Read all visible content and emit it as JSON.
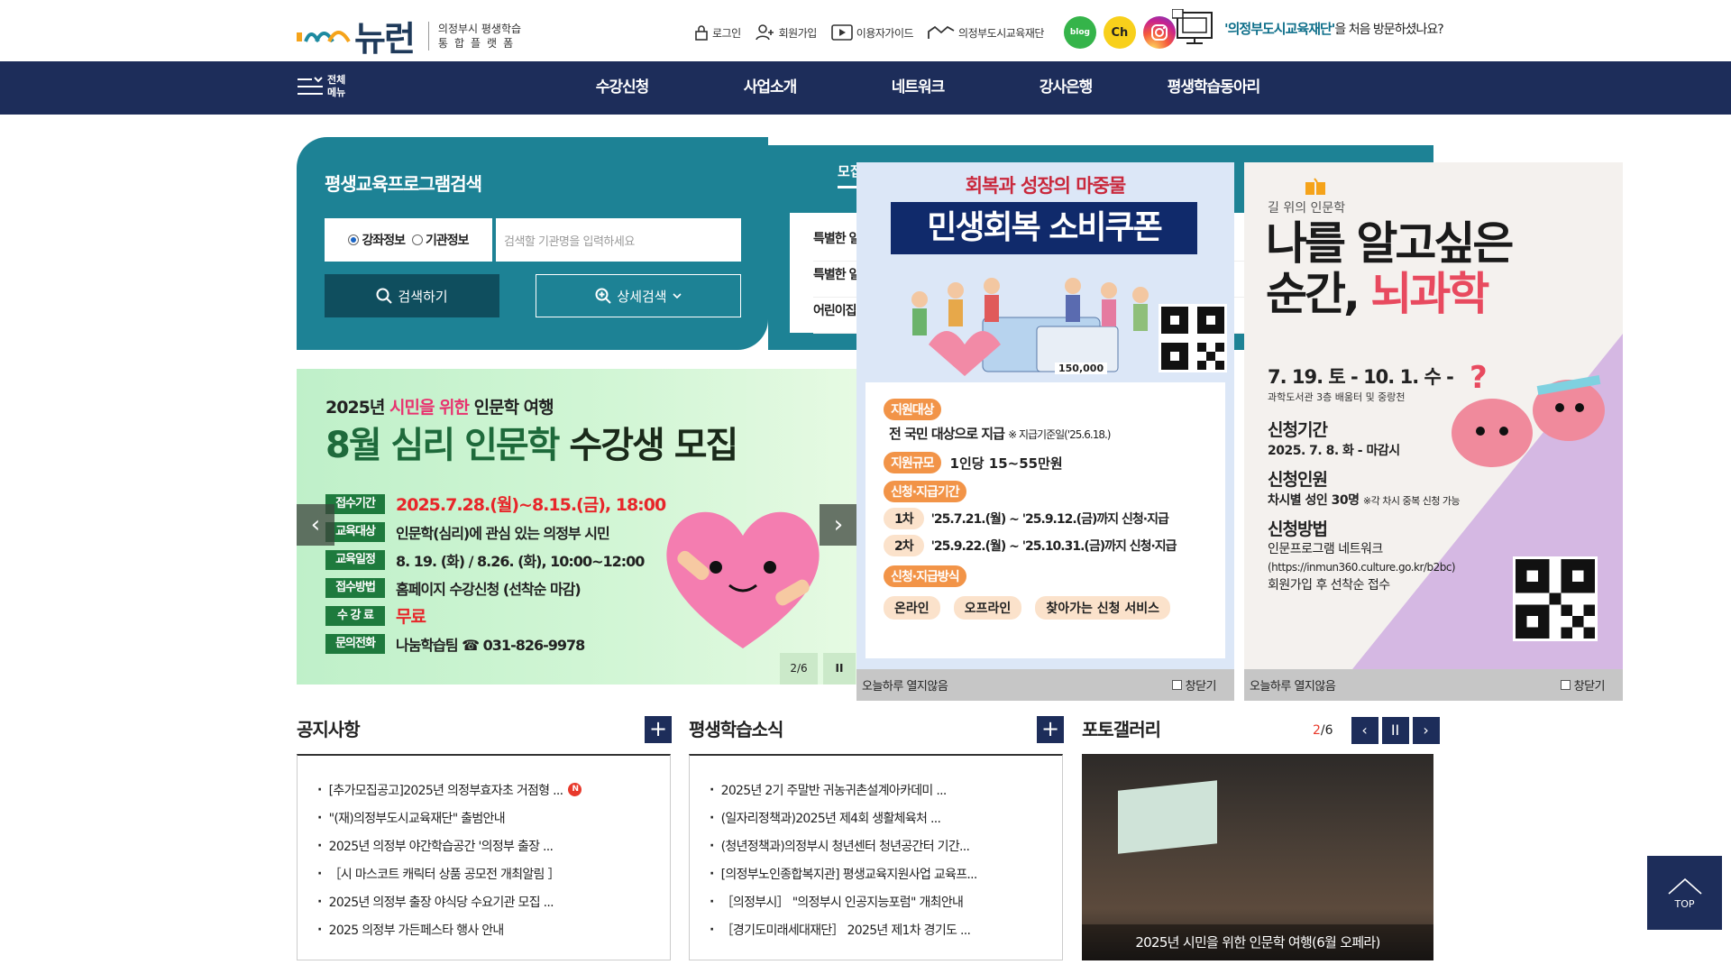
{
  "header": {
    "logo_text": "뉴런",
    "logo_sub1": "의정부시 평생학습",
    "logo_sub2": "통합플랫폼",
    "util": [
      {
        "label": "로그인",
        "icon": "lock-icon"
      },
      {
        "label": "회원가입",
        "icon": "user-plus-icon"
      },
      {
        "label": "이용자가이드",
        "icon": "play-icon"
      },
      {
        "label": "의정부도시교육재단",
        "icon": "chart-icon"
      }
    ],
    "sns": [
      "blog",
      "Ch",
      "instagram"
    ],
    "visit_title": "'의정부도시교육재단'",
    "visit_rest": "을 처음 방문하셨나요?"
  },
  "nav": {
    "allmenu_line1": "전체",
    "allmenu_line2": "메뉴",
    "items": [
      "수강신청",
      "사업소개",
      "네트워크",
      "강사은행",
      "평생학습동아리"
    ]
  },
  "search": {
    "title": "평생교육프로그램검색",
    "radio1": "강좌정보",
    "radio2": "기관정보",
    "placeholder": "검색할 기관명을 입력하세요",
    "btn_search": "검색하기",
    "btn_detail": "상세검색"
  },
  "recruit": {
    "tab": "모집",
    "items": [
      "특별한 일",
      "특별한 일",
      "어린이집"
    ]
  },
  "banner": {
    "sub_pre": "2025년 ",
    "sub_hl": "시민을 위한",
    "sub_post": " 인문학 여행",
    "title_a": "8월 심리 인문학 ",
    "title_b": "수강생 모집",
    "rows": [
      {
        "k": "접수기간",
        "v": "2025.7.28.(월)~8.15.(금), 18:00",
        "red": true
      },
      {
        "k": "교육대상",
        "v": "인문학(심리)에 관심 있는 의정부 시민",
        "red": false
      },
      {
        "k": "교육일정",
        "v": "8. 19. (화) / 8.26. (화), 10:00~12:00",
        "red": false
      },
      {
        "k": "접수방법",
        "v": "홈페이지 수강신청 (선착순 마감)",
        "red": false
      },
      {
        "k": "수 강 료",
        "v": "무료",
        "red": true
      },
      {
        "k": "문의전화",
        "v": "나눔학습팀  ☎ 031-826-9978",
        "red": false
      }
    ],
    "pager": "2/6",
    "pause": "II"
  },
  "popup1": {
    "head": "회복과 성장의 마중물",
    "title": "민생회복 소비쿠폰",
    "coupon": "150,000",
    "tag1": "지원대상",
    "line1": "전 국민 대상으로 지급",
    "line1_note": "※ 지급기준일('25.6.18.)",
    "tag2": "지원규모",
    "line2": "1인당 15~55만원",
    "tag3": "신청·지급기간",
    "step1_n": "1차",
    "step1": "'25.7.21.(월) ~ '25.9.12.(금)까지 신청·지급",
    "step2_n": "2차",
    "step2": "'25.9.22.(월) ~ '25.10.31.(금)까지 신청·지급",
    "tag4": "신청·지급방식",
    "pills": [
      "온라인",
      "오프라인",
      "찾아가는 신청 서비스"
    ],
    "foot_left": "오늘하루 열지않음",
    "foot_right": "창닫기"
  },
  "popup2": {
    "sub": "길 위의 인문학",
    "title1": "나를 알고싶은",
    "title2a": "순간, ",
    "title2b": "뇌과학",
    "date": "7. 19. 토 - 10. 1. 수 -",
    "place": "과학도서관 3층 배움터 및 중랑천",
    "h1": "신청기간",
    "t1": "2025. 7. 8. 화 - 마감시",
    "h2": "신청인원",
    "t2": "차시별 성인 30명",
    "t2_note": "※각 차시 중복 신청 가능",
    "h3": "신청방법",
    "m1": "인문프로그램 네트워크",
    "m2": "(https://inmun360.culture.go.kr/b2bc)",
    "m3": "회원가입 후 선착순 접수",
    "foot_left": "오늘하루 열지않음",
    "foot_right": "창닫기"
  },
  "notice": {
    "title": "공지사항",
    "items": [
      "[추가모집공고]2025년 의정부효자초 거점형 ...",
      "\"(재)의정부도시교육재단\" 출범안내",
      "2025년 의정부 야간학습공간 '의정부 출장 ...",
      "［시 마스코트 캐릭터 상품 공모전 개최알림 ］",
      "2025년 의정부 출장 야식당 수요기관 모집 ...",
      "2025 의정부 가든페스타 행사 안내"
    ],
    "new_badge": "N"
  },
  "news": {
    "title": "평생학습소식",
    "items": [
      "2025년 2기 주말반 귀농귀촌설계아카데미 ...",
      "(일자리정책과)2025년 제4회 생활체육처 ...",
      "(청년정책과)의정부시 청년센터 청년공간터 기간...",
      "[의정부노인종합복지관] 평생교육지원사업 교육프...",
      "［의정부시］ \"의정부시 인공지능포럼\" 개최안내",
      "［경기도미래세대재단］ 2025년 제1차 경기도 ..."
    ]
  },
  "gallery": {
    "title": "포토갤러리",
    "current": "2",
    "total": "/6",
    "caption": "2025년 시민을 위한 인문학 여행(6월 오페라)"
  },
  "top_label": "TOP"
}
